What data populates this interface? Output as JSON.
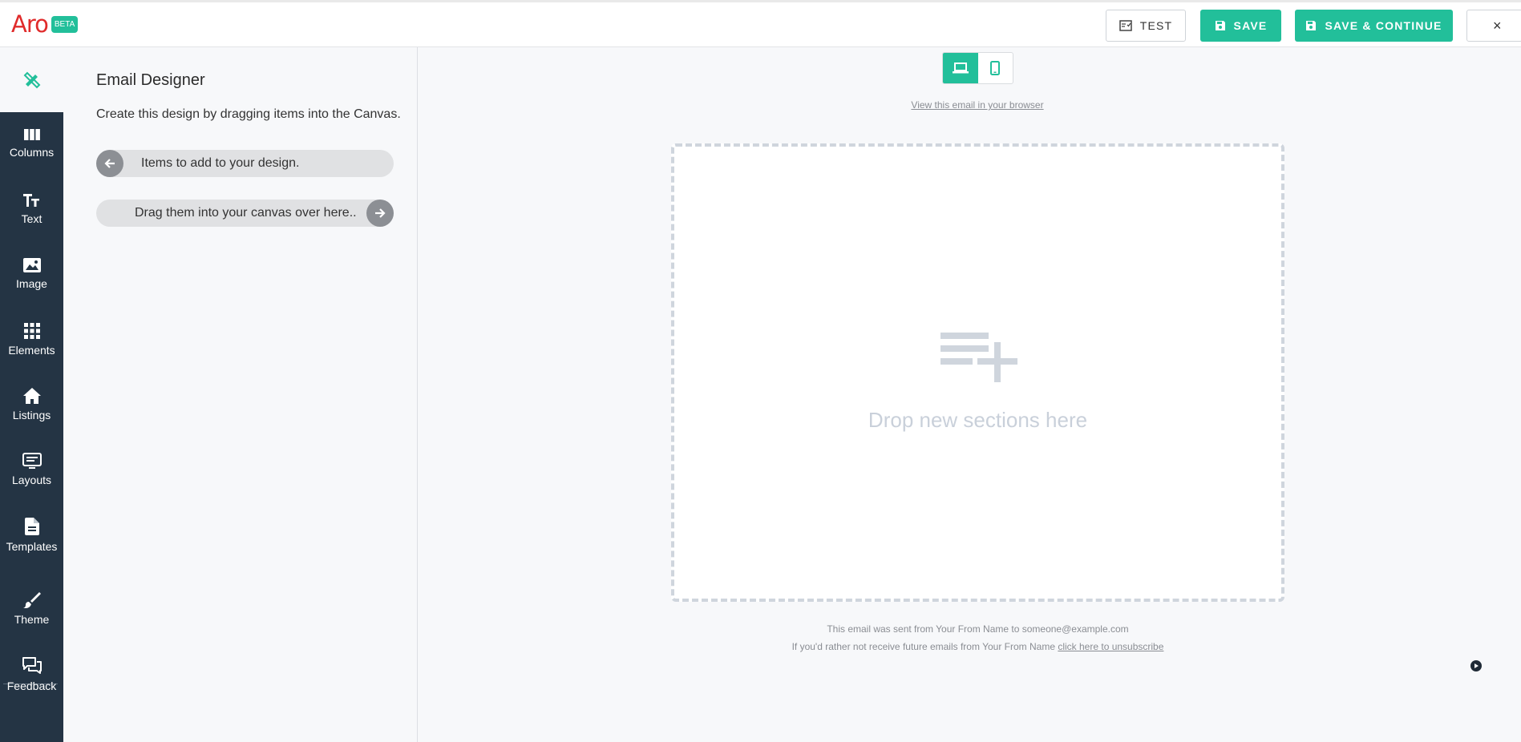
{
  "header": {
    "logo_text": "Aro",
    "badge": "BETA",
    "test_label": "TEST",
    "save_label": "SAVE",
    "save_continue_label": "SAVE & CONTINUE",
    "close_label": "×"
  },
  "sidebar": {
    "items": [
      {
        "label": "Columns",
        "icon": "columns-icon"
      },
      {
        "label": "Text",
        "icon": "text-icon"
      },
      {
        "label": "Image",
        "icon": "image-icon"
      },
      {
        "label": "Elements",
        "icon": "grid-icon"
      },
      {
        "label": "Listings",
        "icon": "home-icon"
      },
      {
        "label": "Layouts",
        "icon": "layouts-icon"
      },
      {
        "label": "Templates",
        "icon": "document-icon"
      },
      {
        "label": "Theme",
        "icon": "brush-icon"
      },
      {
        "label": "Feedback",
        "icon": "chat-icon"
      }
    ]
  },
  "panel": {
    "title": "Email Designer",
    "description": "Create this design by dragging items into the Canvas.",
    "hint_left": "Items to add to your design.",
    "hint_right": "Drag them into your canvas over here.."
  },
  "canvas": {
    "view_link": "View this email in your browser",
    "drop_text": "Drop new sections here",
    "footer_line1": "This email was sent from Your From Name to someone@example.com",
    "footer_line2_prefix": "If you'd rather not receive future emails from Your From Name ",
    "unsubscribe_link": "click here to unsubscribe"
  },
  "colors": {
    "accent": "#22bf9a",
    "rail": "#243444",
    "logo": "#e02b2b"
  }
}
